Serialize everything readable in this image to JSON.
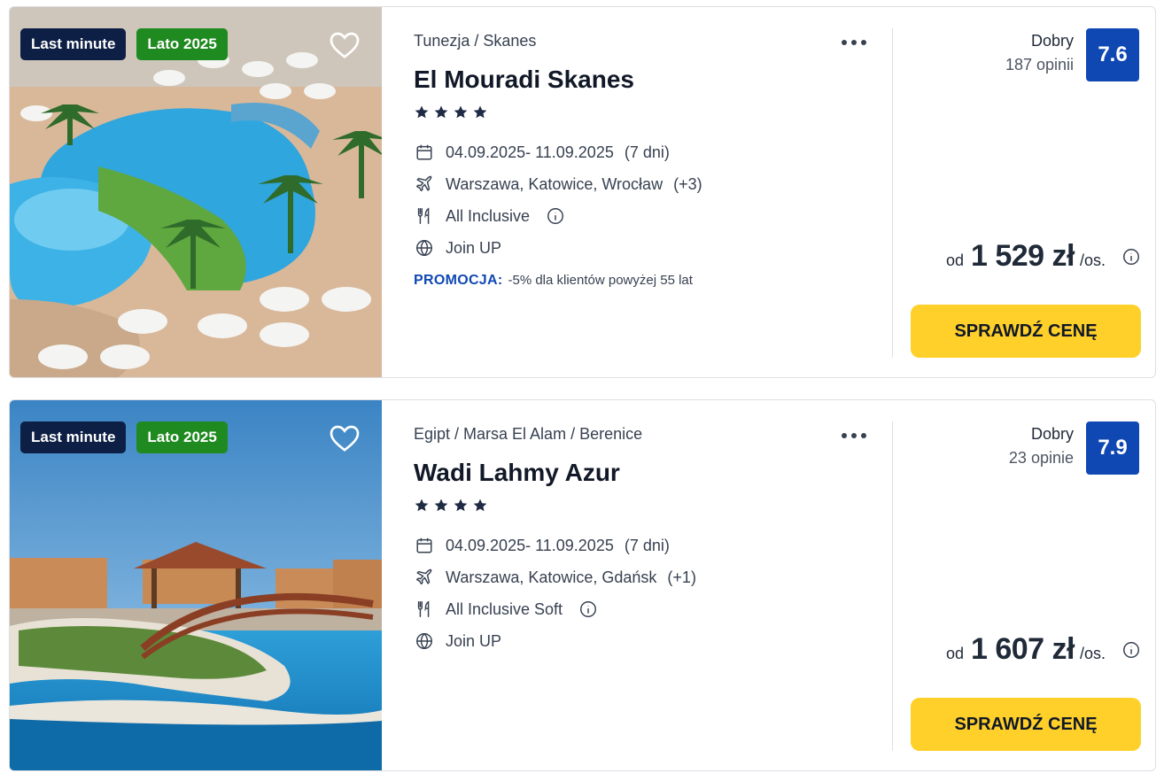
{
  "offers": [
    {
      "badges": {
        "last_minute": "Last minute",
        "season": "Lato 2025"
      },
      "location": "Tunezja / Skanes",
      "hotel_name": "El Mouradi Skanes",
      "stars": 4,
      "dates": "04.09.2025- 11.09.2025",
      "duration": "(7 dni)",
      "departures": "Warszawa, Katowice, Wrocław",
      "departures_more": "(+3)",
      "board": "All Inclusive",
      "transport": "Join UP",
      "promo_label": "PROMOCJA:",
      "promo_text": "-5% dla klientów powyżej 55 lat",
      "rating_label": "Dobry",
      "reviews": "187 opinii",
      "score": "7.6",
      "price_prefix": "od",
      "price": "1 529 zł",
      "price_unit": "/os.",
      "cta": "SPRAWDŹ CENĘ"
    },
    {
      "badges": {
        "last_minute": "Last minute",
        "season": "Lato 2025"
      },
      "location": "Egipt / Marsa El Alam / Berenice",
      "hotel_name": "Wadi Lahmy Azur",
      "stars": 4,
      "dates": "04.09.2025- 11.09.2025",
      "duration": "(7 dni)",
      "departures": "Warszawa, Katowice, Gdańsk",
      "departures_more": "(+1)",
      "board": "All Inclusive Soft",
      "transport": "Join UP",
      "rating_label": "Dobry",
      "reviews": "23 opinie",
      "score": "7.9",
      "price_prefix": "od",
      "price": "1 607 zł",
      "price_unit": "/os.",
      "cta": "SPRAWDŹ CENĘ"
    }
  ],
  "colors": {
    "last_minute_badge": "#0d1f44",
    "season_badge": "#1f8a1f",
    "score_box": "#1048b3",
    "promo_label": "#1048b3",
    "cta_button": "#ffd02a"
  },
  "icons": {
    "favorite": "heart-icon",
    "more": "more-dots-icon",
    "star": "star-icon",
    "dates": "calendar-icon",
    "departures": "plane-icon",
    "board": "cutlery-icon",
    "transport": "globe-icon",
    "info": "info-icon"
  }
}
